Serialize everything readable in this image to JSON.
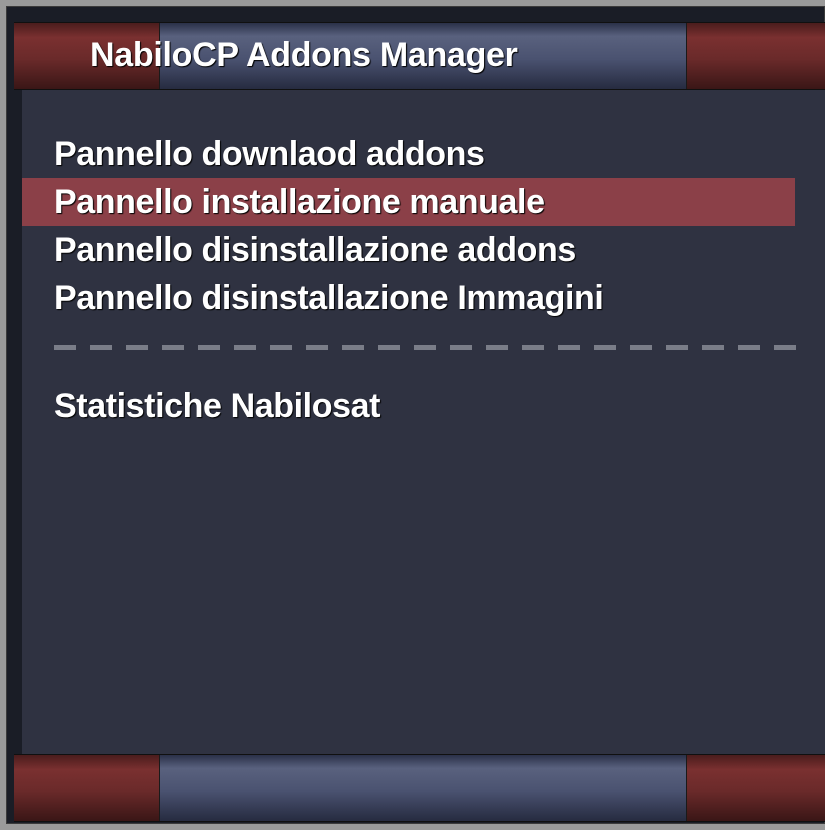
{
  "window": {
    "title": "NabiloCP Addons Manager"
  },
  "menu": {
    "items": [
      {
        "label": "Pannello downlaod addons",
        "selected": false
      },
      {
        "label": "Pannello installazione manuale",
        "selected": true
      },
      {
        "label": "Pannello disinstallazione addons",
        "selected": false
      },
      {
        "label": "Pannello disinstallazione Immagini",
        "selected": false
      }
    ],
    "extra_items": [
      {
        "label": "Statistiche Nabilosat",
        "selected": false
      }
    ]
  },
  "colors": {
    "background": "#2f3241",
    "selection": "#8b4048",
    "bar_red": "#7a3030",
    "bar_blue": "#59617e",
    "text": "#ffffff",
    "separator": "#7a7d88"
  }
}
